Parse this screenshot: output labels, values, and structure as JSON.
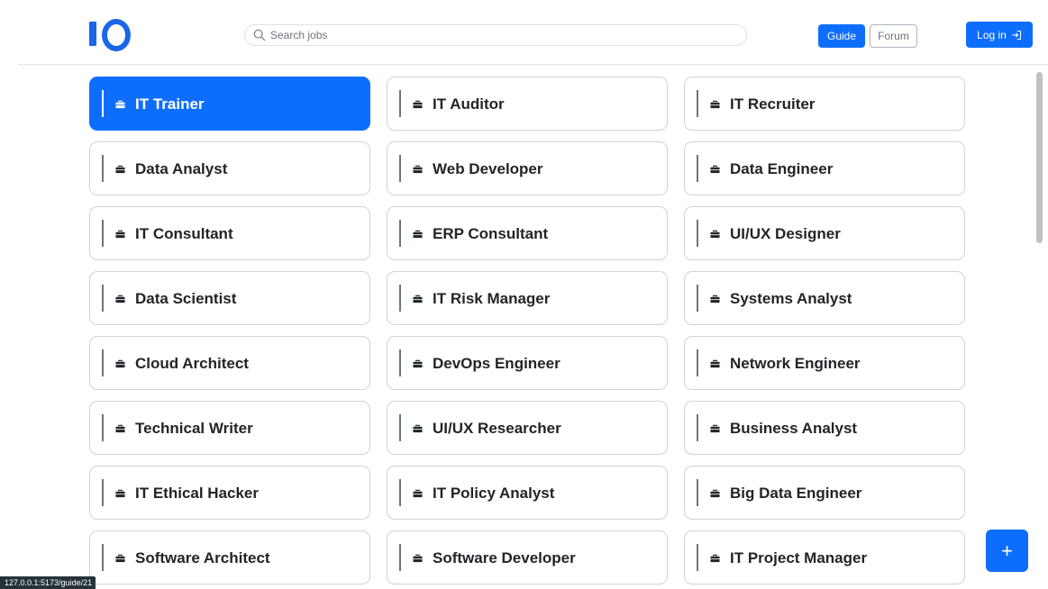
{
  "header": {
    "logo_text": "IO",
    "search": {
      "placeholder": "Search jobs",
      "value": ""
    },
    "guide_label": "Guide",
    "forum_label": "Forum",
    "login_label": "Log in"
  },
  "jobs": [
    {
      "label": "IT Trainer",
      "active": true
    },
    {
      "label": "IT Auditor"
    },
    {
      "label": "IT Recruiter"
    },
    {
      "label": "Data Analyst"
    },
    {
      "label": "Web Developer"
    },
    {
      "label": "Data Engineer"
    },
    {
      "label": "IT Consultant"
    },
    {
      "label": "ERP Consultant"
    },
    {
      "label": "UI/UX Designer"
    },
    {
      "label": "Data Scientist"
    },
    {
      "label": "IT Risk Manager"
    },
    {
      "label": "Systems Analyst"
    },
    {
      "label": "Cloud Architect"
    },
    {
      "label": "DevOps Engineer"
    },
    {
      "label": "Network Engineer"
    },
    {
      "label": "Technical Writer"
    },
    {
      "label": "UI/UX Researcher"
    },
    {
      "label": "Business Analyst"
    },
    {
      "label": "IT Ethical Hacker"
    },
    {
      "label": "IT Policy Analyst"
    },
    {
      "label": "Big Data Engineer"
    },
    {
      "label": "Software Architect"
    },
    {
      "label": "Software Developer"
    },
    {
      "label": "IT Project Manager"
    }
  ],
  "fab_label": "+",
  "status_url": "127.0.0.1:5173/guide/21",
  "colors": {
    "primary": "#0d6efd",
    "logo": "#1a66e8",
    "card_border": "#ced4da"
  }
}
